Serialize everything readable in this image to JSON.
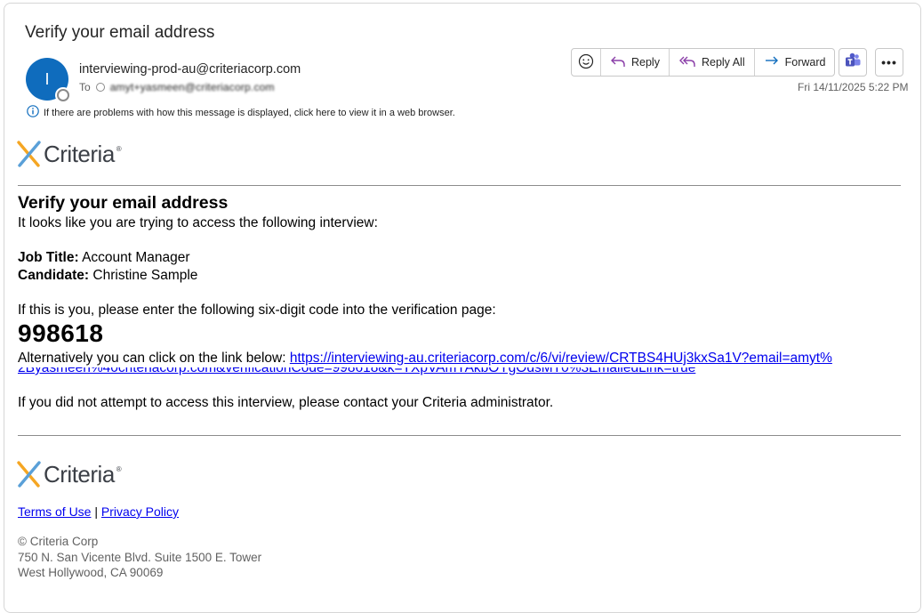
{
  "header": {
    "subject": "Verify your email address",
    "avatar_initial": "I",
    "sender": "interviewing-prod-au@criteriacorp.com",
    "to_label": "To",
    "to_address": "amyt+yasmeen@criteriacorp.com",
    "datetime": "Fri 14/11/2025 5:22 PM",
    "info_notice": "If there are problems with how this message is displayed, click here to view it in a web browser."
  },
  "toolbar": {
    "emoji_icon": "smiley-icon",
    "reply_label": "Reply",
    "reply_all_label": "Reply All",
    "forward_label": "Forward",
    "teams_icon": "teams-icon",
    "more_label": "•••"
  },
  "email": {
    "logo_text": "Criteria",
    "logo_reg": "®",
    "heading": "Verify your email address",
    "intro": "It looks like you are trying to access the following interview:",
    "job_title_label": "Job Title:",
    "job_title_value": "Account Manager",
    "candidate_label": "Candidate:",
    "candidate_value": "Christine Sample",
    "code_intro": "If this is you, please enter the following six-digit code into the verification page:",
    "code": "998618",
    "alt_text": "Alternatively you can click on the link below:",
    "link_line1": "https://interviewing-au.criteriacorp.com/c/6/vi/review/CRTBS4HUj3kxSa1V?email=amyt%",
    "link_line2": "2Byasmeen%40criteriacorp.com&verificationCode=998618&k=TXpVAmYAkbOYgOdsMT0%3EmailedLink=true",
    "not_you": "If you did not attempt to access this interview, please contact your Criteria administrator."
  },
  "footer": {
    "logo_text": "Criteria",
    "logo_reg": "®",
    "terms": "Terms of Use",
    "divider": "|",
    "privacy": "Privacy Policy",
    "copyright": "© Criteria Corp",
    "address1": "750 N. San Vicente Blvd. Suite 1500 E. Tower",
    "address2": "West Hollywood, CA 90069"
  },
  "colors": {
    "avatar": "#0f6cbd",
    "link": "#0000ee",
    "reply_icon": "#8a3ea8",
    "forward_icon": "#0f6cbd",
    "logo_orange": "#f5a623",
    "logo_blue": "#5aa0d8"
  }
}
